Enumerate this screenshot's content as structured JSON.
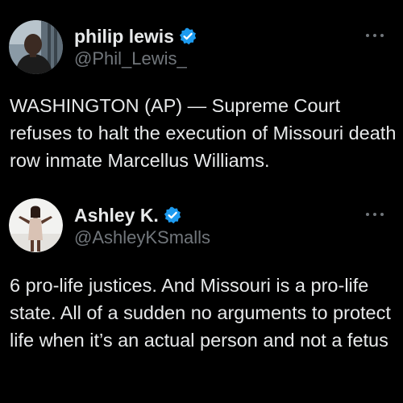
{
  "colors": {
    "background": "#000000",
    "text_primary": "#e7e9ea",
    "text_secondary": "#71767b",
    "verified_badge": "#1d9bf0"
  },
  "tweets": [
    {
      "display_name": "philip lewis",
      "handle": "@Phil_Lewis_",
      "verified": true,
      "avatar_icon": "avatar-photo",
      "more_icon": "more-horizontal-icon",
      "text": "WASHINGTON (AP) — Supreme Court refuses to halt the execution of Missouri death row inmate Marcellus Williams."
    },
    {
      "display_name": "Ashley K.",
      "handle": "@AshleyKSmalls",
      "verified": true,
      "avatar_icon": "avatar-photo",
      "more_icon": "more-horizontal-icon",
      "text": "6 pro-life justices. And Missouri is a pro-life state. All of a sudden no arguments to protect life when it’s an actual person and not a fetus"
    }
  ]
}
